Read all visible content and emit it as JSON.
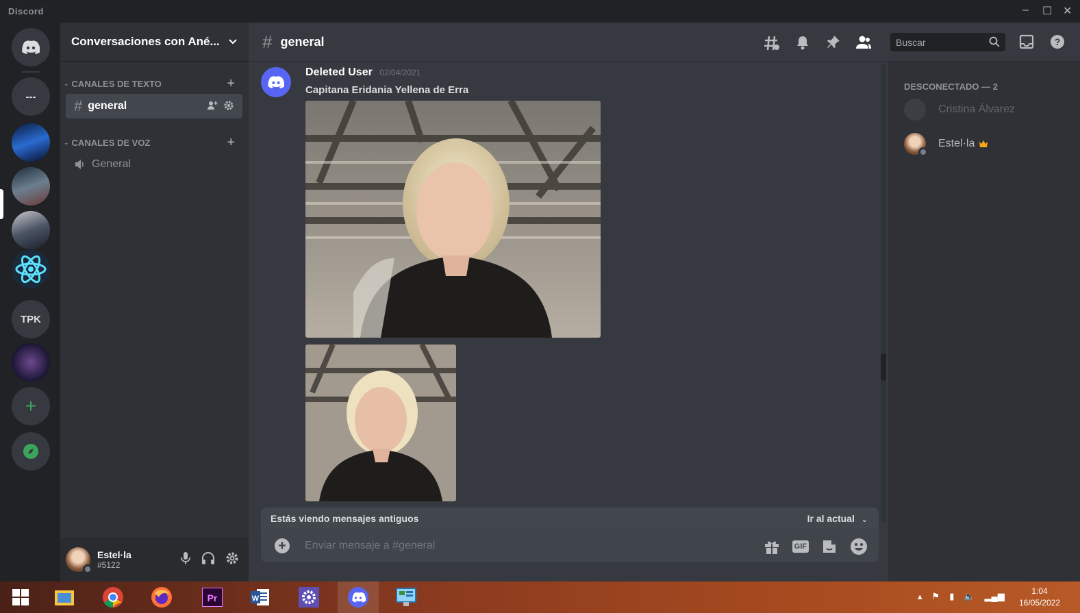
{
  "window": {
    "title": "Discord",
    "controls": [
      "–",
      "☐",
      "✕"
    ]
  },
  "servers": [
    {
      "kind": "home",
      "icon": "discord-logo-icon"
    },
    {
      "kind": "text",
      "label": "---"
    },
    {
      "kind": "image",
      "icon": "server-avatar-icon"
    },
    {
      "kind": "image",
      "icon": "server-avatar-icon",
      "selected": true
    },
    {
      "kind": "image",
      "icon": "server-avatar-icon"
    },
    {
      "kind": "image",
      "icon": "atom-icon"
    },
    {
      "kind": "text",
      "label": "TPK"
    },
    {
      "kind": "image",
      "icon": "server-avatar-icon"
    },
    {
      "kind": "add",
      "label": "+"
    },
    {
      "kind": "explore",
      "icon": "compass-icon"
    }
  ],
  "guild": {
    "name": "Conversaciones con Ané...",
    "categories": [
      {
        "label": "CANALES DE TEXTO",
        "channels": [
          {
            "name": "general",
            "active": true
          }
        ]
      },
      {
        "label": "CANALES DE VOZ",
        "channels": [
          {
            "name": "General",
            "voice": true
          }
        ]
      }
    ]
  },
  "user": {
    "name": "Estel·la",
    "discriminator": "#5122"
  },
  "channel": {
    "hash": "#",
    "name": "general"
  },
  "search": {
    "placeholder": "Buscar"
  },
  "message": {
    "author": "Deleted User",
    "timestamp": "02/04/2021",
    "content": "Capitana Eridania Yellena de  Erra"
  },
  "old_messages_bar": {
    "text": "Estás viendo mensajes antiguos",
    "jump": "Ir al actual"
  },
  "composer": {
    "placeholder": "Enviar mensaje a #general",
    "gif_label": "GIF"
  },
  "members": {
    "category": "DESCONECTADO — 2",
    "list": [
      {
        "name": "Cristina Álvarez",
        "status": "offline"
      },
      {
        "name": "Estel·la",
        "owner": true
      }
    ]
  },
  "taskbar": {
    "apps": [
      "start-icon",
      "file-explorer-icon",
      "chrome-icon",
      "firefox-icon",
      "premiere-icon",
      "word-icon",
      "settings-icon",
      "discord-icon",
      "control-panel-icon"
    ],
    "time": "1:04",
    "date": "16/05/2022"
  },
  "colors": {
    "blurple": "#5865f2",
    "green": "#3ba55d",
    "crown": "#faa61a"
  }
}
